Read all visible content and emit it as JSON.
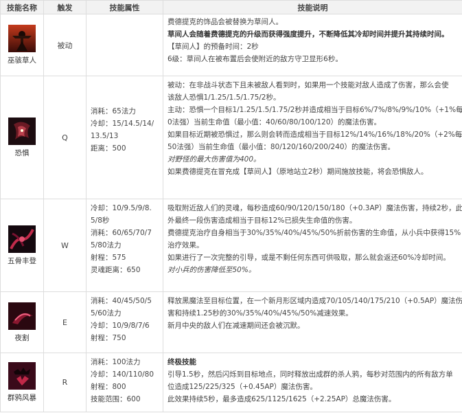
{
  "headers": {
    "col1": "技能名称",
    "col2": "触发",
    "col3": "技能属性",
    "col4": "技能说明"
  },
  "icons": {
    "passive": "scarecrow-icon",
    "q": "terrify-icon",
    "w": "drain-icon",
    "e": "dark-wind-icon",
    "r": "crowstorm-icon"
  },
  "passive": {
    "name": "巫骇草人",
    "key": "被动",
    "desc": [
      "费德提克的饰品会被替换为草间人。",
      "草间人会随着费德提克的升级而获得强度提升，不断降低其冷却时间并提升其持续时间。",
      "【草间人】的预备时间：2秒",
      "6级：草间人在被布置后会使附近的敌方守卫显形6秒。"
    ]
  },
  "q": {
    "name": "恐惧",
    "key": "Q",
    "attrs": [
      "消耗：65法力",
      "冷却：15/14.5/14/",
      "13.5/13",
      "距离：500"
    ],
    "desc": [
      "被动：在非战斗状态下且未被敌人看到时，如果用一个技能对敌人造成了伤害，那么会使",
      "该敌人恐惧1/1.25/1.5/1.75/2秒。",
      "主动：恐惧一个目标1/1.25/1.5/1.75/2秒并造成相当于目标6%/7%/8%/9%/10%（+1%每5",
      "0法强）当前生命值（最小值：40/60/80/100/120）的魔法伤害。",
      "如果目标近期被恐惧过，那么则会转而造成相当于目标12%/14%/16%/18%/20%（+2%每",
      "50法强）当前生命值（最小值：80/120/160/200/240）的魔法伤害。",
      "对野怪的最大伤害值为400。",
      "如果费德提克在冒充成【草间人】（原地站立2秒）期间施放技能，将会恐惧敌人。"
    ]
  },
  "w": {
    "name": "五骨丰登",
    "key": "W",
    "attrs": [
      "冷却：10/9.5/9/8.",
      "5/8秒",
      "消耗：60/65/70/7",
      "5/80法力",
      "射程：575",
      "灵魂距离：650"
    ],
    "desc": [
      "吸取附近敌人们的灵魂，每秒造成60/90/120/150/180（+0.3AP）魔法伤害，持续2秒，此",
      "外最终一段伤害造成相当于目标12%已损失生命值的伤害。",
      "费德提克治疗自身相当于30%/35%/40%/45%/50%折前伤害的生命值，从小兵中获得15%",
      "治疗效果。",
      "如果进行了一次完整的引导，或是不剩任何东西可供吸取，那么就会返还60%冷却时间。",
      "对小兵的伤害降低至50%。"
    ]
  },
  "e": {
    "name": "夜割",
    "key": "E",
    "attrs": [
      "消耗：40/45/50/5",
      "5/60法力",
      "冷却：10/9/8/7/6",
      "射程：750"
    ],
    "desc": [
      "释放黑魔法至目标位置，在一个新月形区域内造成70/105/140/175/210（+0.5AP）魔法伤",
      "害和持续1.25秒的30%/35%/40%/45%/50%减速效果。",
      "新月中央的敌人们在减速期间还会被沉默。"
    ]
  },
  "r": {
    "name": "群鸦风暴",
    "key": "R",
    "attrs": [
      "消耗：100法力",
      "冷却：140/110/80",
      "射程：800",
      "技能范围：600"
    ],
    "desc": [
      "终极技能",
      "引导1.5秒，然后闪烁到目标地点，同时释放出成群的杀人鸦，每秒对范围内的所有敌方单",
      "位造成125/225/325（+0.45AP）魔法伤害。",
      "此效果持续5秒，最多造成625/1125/1625（+2.25AP）总魔法伤害。"
    ]
  }
}
